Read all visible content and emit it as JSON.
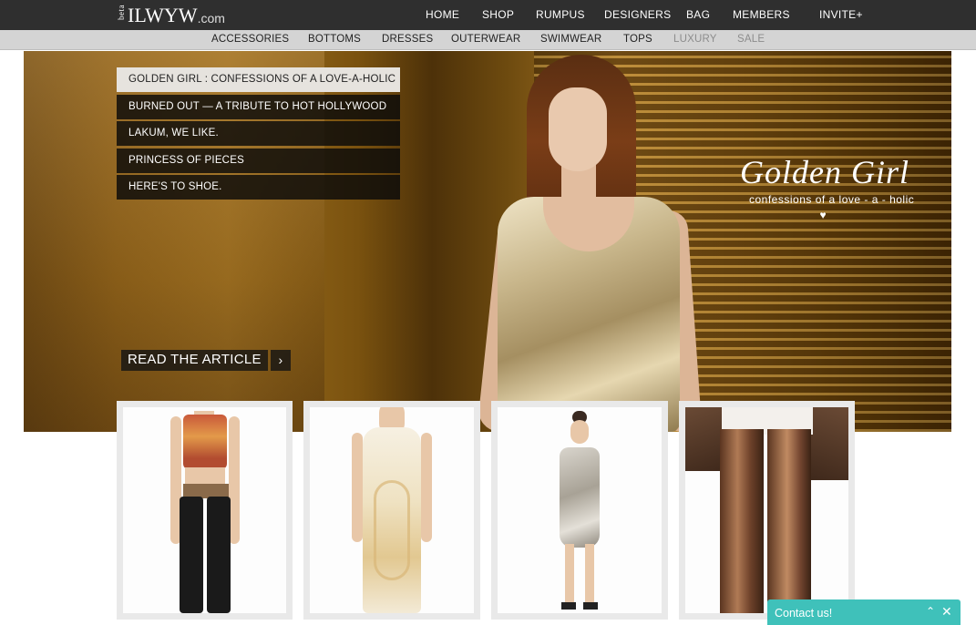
{
  "header": {
    "logo": {
      "beta": "beta",
      "name": "ILWYW",
      "suffix": ".com"
    },
    "nav": [
      "HOME",
      "SHOP",
      "RUMPUS",
      "DESIGNERS",
      "BAG",
      "MEMBERS",
      "INVITE+"
    ]
  },
  "subnav": [
    "ACCESSORIES",
    "BOTTOMS",
    "DRESSES",
    "OUTERWEAR",
    "SWIMWEAR",
    "TOPS",
    "LUXURY",
    "SALE"
  ],
  "hero": {
    "articles": [
      "GOLDEN GIRL : CONFESSIONS OF A LOVE-A-HOLIC",
      "BURNED OUT — A TRIBUTE TO HOT HOLLYWOOD",
      "LAKUM, WE LIKE.",
      "PRINCESS OF PIECES",
      "HERE'S TO SHOE."
    ],
    "title": "Golden Girl",
    "subtitle": "confessions of a love - a - holic",
    "heart": "♥",
    "read_label": "READ THE ARTICLE",
    "read_arrow": "›"
  },
  "contact": {
    "label": "Contact us!",
    "minimize": "⌃",
    "close": "✕"
  },
  "colors": {
    "topbar": "#2f2f2f",
    "subbar": "#d4d4d4",
    "contact": "#3fc1ba"
  }
}
